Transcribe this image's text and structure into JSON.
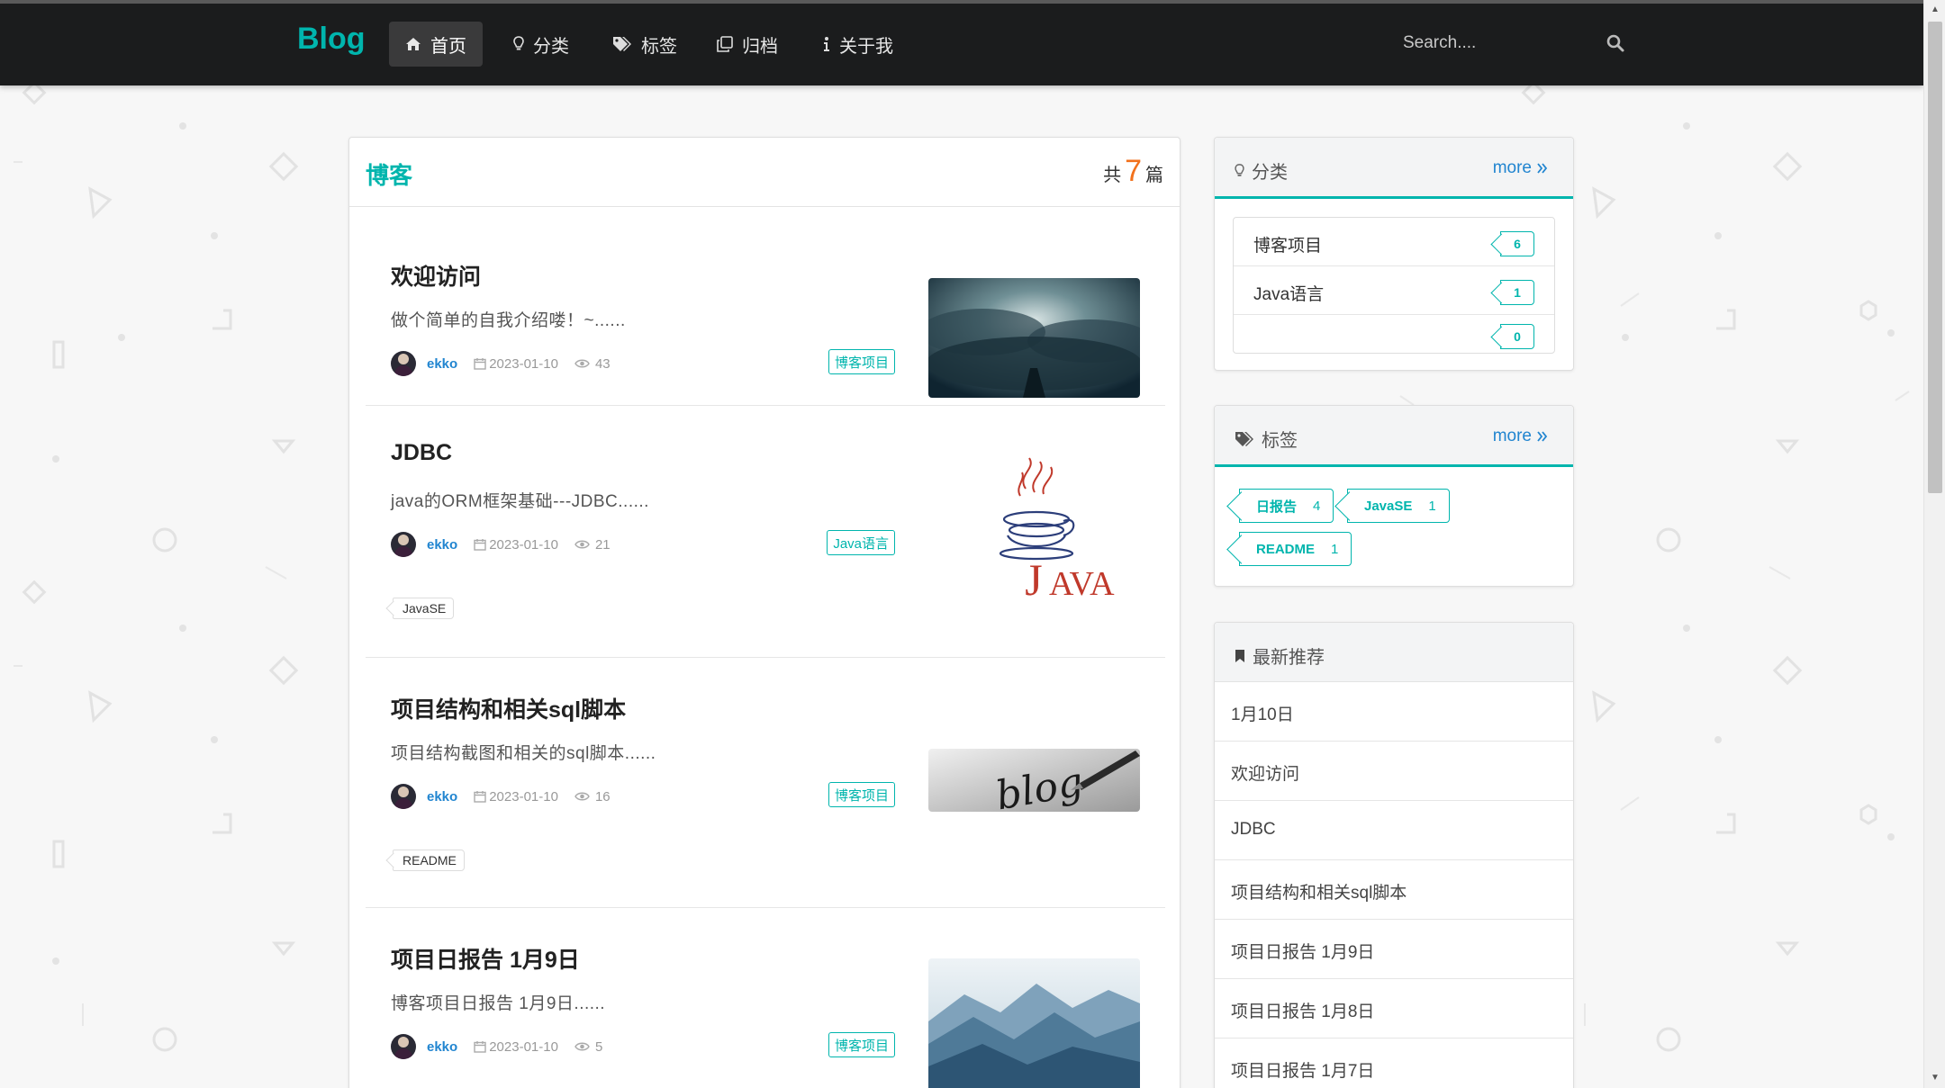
{
  "navbar": {
    "brand": "Blog",
    "items": [
      {
        "label": "首页",
        "icon": "home-icon",
        "active": true
      },
      {
        "label": "分类",
        "icon": "lightbulb-icon"
      },
      {
        "label": "标签",
        "icon": "tags-icon"
      },
      {
        "label": "归档",
        "icon": "clone-icon"
      },
      {
        "label": "关于我",
        "icon": "info-icon"
      }
    ],
    "search_placeholder": "Search...."
  },
  "main": {
    "title": "博客",
    "count_prefix": "共",
    "count": "7",
    "count_suffix": "篇",
    "posts": [
      {
        "title": "欢迎访问",
        "summary": "做个简单的自我介绍喽！~......",
        "author": "ekko",
        "date": "2023-01-10",
        "views": "43",
        "category": "博客项目",
        "tag": "",
        "image": "cloud-boat-image"
      },
      {
        "title": "JDBC",
        "summary": "java的ORM框架基础---JDBC......",
        "author": "ekko",
        "date": "2023-01-10",
        "views": "21",
        "category": "Java语言",
        "tag": "JavaSE",
        "image": "java-logo-image"
      },
      {
        "title": "项目结构和相关sql脚本",
        "summary": "项目结构截图和相关的sql脚本......",
        "author": "ekko",
        "date": "2023-01-10",
        "views": "16",
        "category": "博客项目",
        "tag": "README",
        "image": "blog-pen-image"
      },
      {
        "title": "项目日报告 1月9日",
        "summary": "博客项目日报告 1月9日......",
        "author": "ekko",
        "date": "2023-01-10",
        "views": "5",
        "category": "博客项目",
        "tag": "",
        "image": "mountain-lake-image"
      }
    ]
  },
  "sidebar": {
    "categories": {
      "title": "分类",
      "more": "more",
      "items": [
        {
          "name": "博客项目",
          "count": "6"
        },
        {
          "name": "Java语言",
          "count": "1"
        },
        {
          "name": "",
          "count": "0"
        }
      ]
    },
    "tags": {
      "title": "标签",
      "more": "more",
      "items": [
        {
          "name": "日报告",
          "count": "4"
        },
        {
          "name": "JavaSE",
          "count": "1"
        },
        {
          "name": "README",
          "count": "1"
        }
      ]
    },
    "recommend": {
      "title": "最新推荐",
      "items": [
        "1月10日",
        "欢迎访问",
        "JDBC",
        "项目结构和相关sql脚本",
        "项目日报告 1月9日",
        "项目日报告 1月8日",
        "项目日报告 1月7日"
      ]
    }
  },
  "colors": {
    "accent": "#00b5ad",
    "navbar": "#1b1c1d",
    "link": "#2185d0",
    "count_orange": "#f2711c"
  }
}
